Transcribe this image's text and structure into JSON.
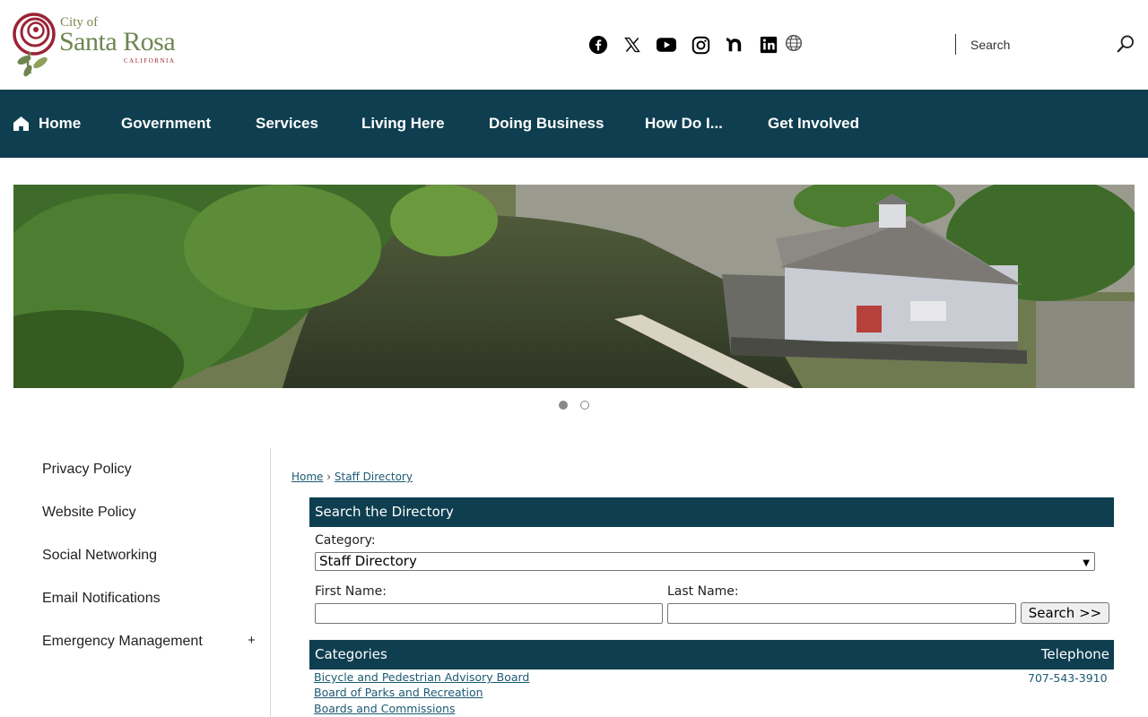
{
  "header": {
    "logo": {
      "line1": "City of",
      "line2": "Santa Rosa",
      "line3": "CALIFORNIA"
    },
    "social_icons": [
      "facebook-icon",
      "x-icon",
      "youtube-icon",
      "instagram-icon",
      "nextdoor-icon",
      "linkedin-icon",
      "translate-globe-icon"
    ],
    "search": {
      "placeholder": "Search"
    }
  },
  "nav": {
    "items": [
      {
        "label": "Home",
        "icon": "home-icon"
      },
      {
        "label": "Government"
      },
      {
        "label": "Services"
      },
      {
        "label": "Living Here"
      },
      {
        "label": "Doing Business"
      },
      {
        "label": "How Do I..."
      },
      {
        "label": "Get Involved"
      }
    ]
  },
  "banner": {
    "slides": 2,
    "active_slide": 1
  },
  "sidebar": {
    "items": [
      {
        "label": "Privacy Policy"
      },
      {
        "label": "Website Policy"
      },
      {
        "label": "Social Networking"
      },
      {
        "label": "Email Notifications"
      },
      {
        "label": "Emergency Management",
        "expand": "+"
      }
    ]
  },
  "breadcrumb": {
    "home": "Home",
    "separator": "›",
    "current": "Staff Directory"
  },
  "directory": {
    "title": "Search the Directory",
    "category_label": "Category:",
    "category_value": "Staff Directory",
    "first_name_label": "First Name:",
    "last_name_label": "Last Name:",
    "search_button": "Search >>"
  },
  "categories": {
    "header_left": "Categories",
    "header_right": "Telephone",
    "rows": [
      {
        "name": "Bicycle and Pedestrian Advisory Board",
        "phone": "707-543-3910"
      },
      {
        "name": "Board of Parks and Recreation",
        "phone": ""
      },
      {
        "name": "Boards and Commissions",
        "phone": ""
      }
    ]
  },
  "colors": {
    "brand": "#0e3e4f",
    "link": "#1c5a73",
    "logo_green": "#6f8550",
    "logo_rose": "#9b2335"
  }
}
